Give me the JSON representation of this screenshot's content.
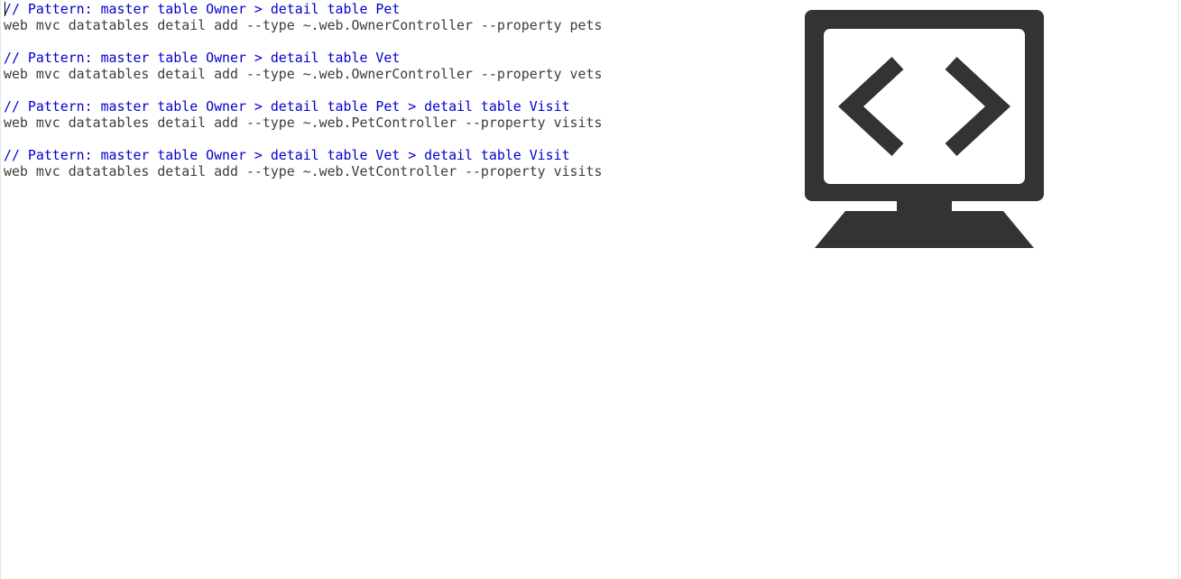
{
  "editor": {
    "lines": [
      {
        "kind": "comment",
        "text": "// Pattern: master table Owner > detail table Pet"
      },
      {
        "kind": "code",
        "text": "web mvc datatables detail add --type ~.web.OwnerController --property pets"
      },
      {
        "kind": "blank",
        "text": ""
      },
      {
        "kind": "comment",
        "text": "// Pattern: master table Owner > detail table Vet"
      },
      {
        "kind": "code",
        "text": "web mvc datatables detail add --type ~.web.OwnerController --property vets"
      },
      {
        "kind": "blank",
        "text": ""
      },
      {
        "kind": "comment",
        "text": "// Pattern: master table Owner > detail table Pet > detail table Visit"
      },
      {
        "kind": "code",
        "text": "web mvc datatables detail add --type ~.web.PetController --property visits"
      },
      {
        "kind": "blank",
        "text": ""
      },
      {
        "kind": "comment",
        "text": "// Pattern: master table Owner > detail table Vet > detail table Visit"
      },
      {
        "kind": "code",
        "text": "web mvc datatables detail add --type ~.web.VetController --property visits"
      }
    ]
  },
  "logo": {
    "icon": "monitor-code-icon",
    "color": "#333333"
  },
  "colors": {
    "comment": "#0000cc",
    "code": "#3c3c3c",
    "background": "#ffffff"
  }
}
